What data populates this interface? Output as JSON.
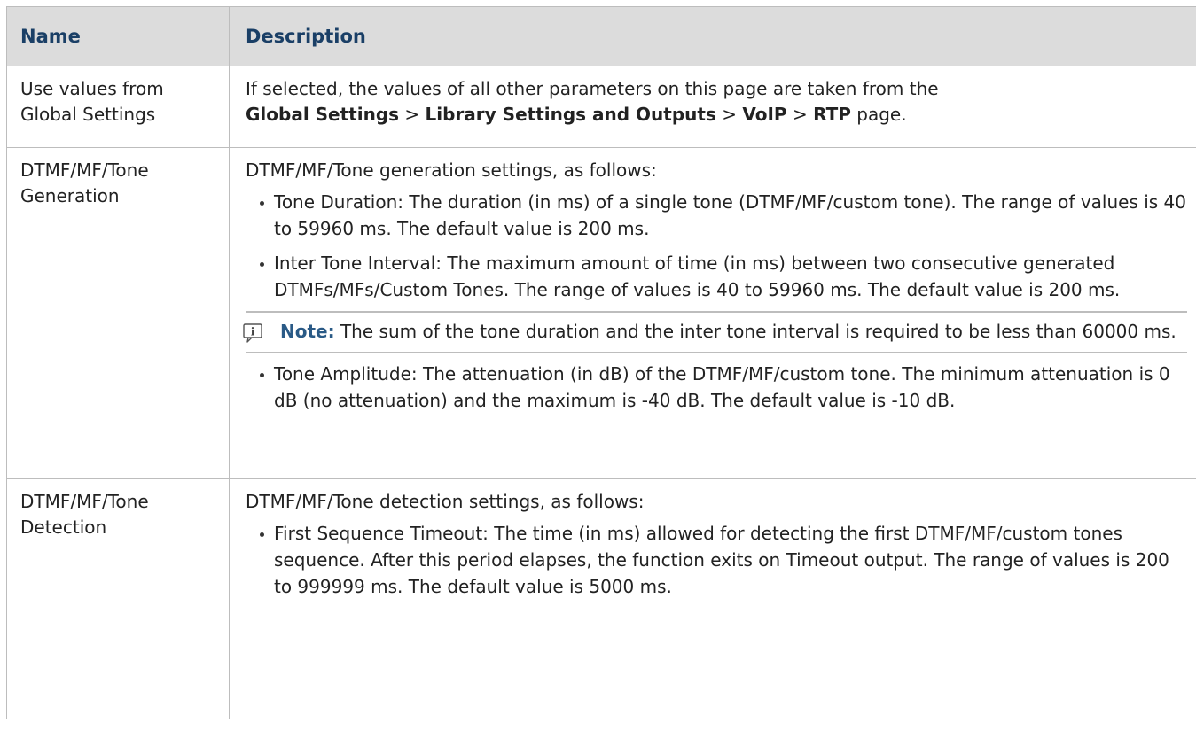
{
  "table": {
    "headers": {
      "name": "Name",
      "description": "Description"
    },
    "row_use_values": {
      "name_line1": "Use values from",
      "name_line2": "Global Settings",
      "desc_prefix": "If selected, the values of all other parameters on this page are taken from the",
      "path_global": "Global Settings",
      "sep": ">",
      "path_library": "Library Settings and Outputs",
      "path_voip": "VoIP",
      "path_rtp": "RTP",
      "desc_suffix": "page."
    },
    "row_generation": {
      "name_line1": "DTMF/MF/Tone",
      "name_line2": "Generation",
      "intro": "DTMF/MF/Tone generation settings, as follows:",
      "bullets": [
        "Tone Duration: The duration (in ms) of a single tone (DTMF/MF/custom tone). The range of values is 40 to 59960 ms. The default value is 200 ms.",
        "Inter Tone Interval: The maximum amount of time (in ms) between two consecutive generated DTMFs/MFs/Custom Tones. The range of values is 40 to 59960 ms. The default value is 200 ms."
      ],
      "note_label": "Note:",
      "note_text": "The sum of the tone duration and the inter tone interval is required to be less than 60000 ms.",
      "bullets_after": [
        "Tone Amplitude: The attenuation (in dB) of the DTMF/MF/custom tone. The minimum attenuation is 0 dB (no attenuation) and the maximum is -40 dB. The default value is -10 dB."
      ]
    },
    "row_detection": {
      "name_line1": "DTMF/MF/Tone",
      "name_line2": "Detection",
      "intro": "DTMF/MF/Tone detection settings, as follows:",
      "bullets": [
        "First Sequence Timeout: The time (in ms) allowed for detecting the first DTMF/MF/custom tones sequence. After this period elapses, the function exits on Timeout output. The range of values is 200 to 999999 ms. The default value is 5000 ms."
      ]
    }
  },
  "icons": {
    "note": "info-icon"
  },
  "colors": {
    "header_bg": "#dcdcdc",
    "header_text": "#1a3f66",
    "note_label": "#2a5a86",
    "border": "#bdbdbd"
  }
}
